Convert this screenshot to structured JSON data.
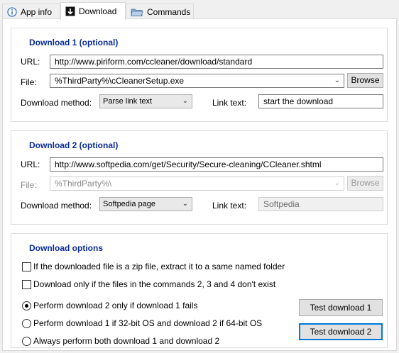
{
  "tabs": [
    {
      "label": "App info",
      "icon": "info-icon"
    },
    {
      "label": "Download",
      "icon": "download-arrow-icon"
    },
    {
      "label": "Commands",
      "icon": "folder-icon"
    }
  ],
  "download1": {
    "title": "Download 1 (optional)",
    "url_label": "URL:",
    "url_value": "http://www.piriform.com/ccleaner/download/standard",
    "file_label": "File:",
    "file_value": "%ThirdParty%\\cCleanerSetup.exe",
    "browse_label": "Browse",
    "method_label": "Download method:",
    "method_value": "Parse link text",
    "linktext_label": "Link text:",
    "linktext_value": "start the download"
  },
  "download2": {
    "title": "Download 2 (optional)",
    "url_label": "URL:",
    "url_value": "http://www.softpedia.com/get/Security/Secure-cleaning/CCleaner.shtml",
    "file_label": "File:",
    "file_value": "%ThirdParty%\\",
    "browse_label": "Browse",
    "method_label": "Download method:",
    "method_value": "Softpedia page",
    "linktext_label": "Link text:",
    "linktext_value": "Softpedia"
  },
  "options": {
    "title": "Download options",
    "checkbox1": "If the downloaded file is a zip file, extract it to a same named folder",
    "checkbox2": "Download only if the files in the commands 2, 3 and 4 don't exist",
    "radio1": "Perform download 2 only if download 1 fails",
    "radio2": "Perform download 1 if 32-bit OS and download 2 if 64-bit OS",
    "radio3": "Always perform both download 1 and download 2",
    "test1_label": "Test download 1",
    "test2_label": "Test download 2"
  },
  "colors": {
    "group_title": "#0a2d9b",
    "focus_border": "#0078d7"
  }
}
